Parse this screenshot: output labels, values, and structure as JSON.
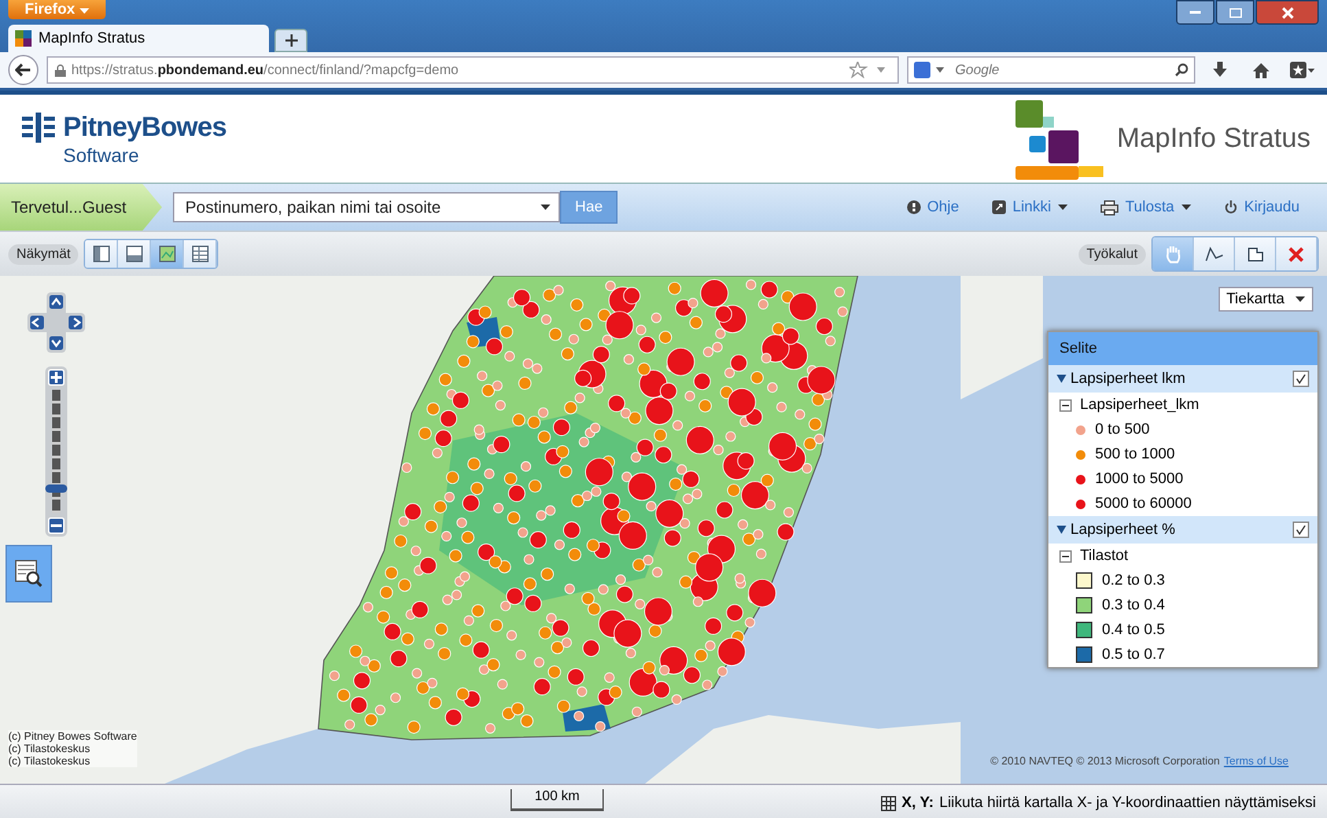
{
  "browser": {
    "app_button": "Firefox",
    "tab_title": "MapInfo Stratus",
    "url": "https://stratus.**pbondemand.eu**/connect/finland/?mapcfg=demo",
    "search_placeholder": "Google"
  },
  "header": {
    "company": "PitneyBowes",
    "company_sub": "Software",
    "product": "MapInfo Stratus"
  },
  "toolbar": {
    "welcome": "Tervetul...Guest",
    "search_placeholder": "Postinumero, paikan nimi tai osoite",
    "search_button": "Hae",
    "links": [
      {
        "label": "Ohje",
        "kind": "help",
        "dropdown": false
      },
      {
        "label": "Linkki",
        "kind": "share",
        "dropdown": true
      },
      {
        "label": "Tulosta",
        "kind": "print",
        "dropdown": true
      },
      {
        "label": "Kirjaudu",
        "kind": "power",
        "dropdown": false
      }
    ]
  },
  "views": {
    "label": "Näkymät",
    "buttons": [
      {
        "kind": "left-panel",
        "selected": false
      },
      {
        "kind": "bottom-panel",
        "selected": false
      },
      {
        "kind": "map",
        "selected": true
      },
      {
        "kind": "table",
        "selected": false
      }
    ]
  },
  "tools": {
    "label": "Työkalut",
    "buttons": [
      {
        "kind": "pan",
        "selected": true
      },
      {
        "kind": "measure",
        "selected": false
      },
      {
        "kind": "area",
        "selected": false
      },
      {
        "kind": "clear",
        "selected": false
      }
    ]
  },
  "map": {
    "basemap": "Tiekartta",
    "zoom_slider": {
      "level": 0.2
    },
    "attribution": [
      "(c) Pitney Bowes Software",
      "(c) Tilastokeskus",
      "(c) Tilastokeskus"
    ],
    "copyright": "© 2010 NAVTEQ © 2013 Microsoft Corporation",
    "terms": "Terms of Use",
    "scale": "100 km"
  },
  "legend": {
    "title": "Selite",
    "layers": [
      {
        "name": "Lapsiperheet lkm",
        "checked": true,
        "expanded": true,
        "group": "Lapsiperheet_lkm",
        "items": [
          {
            "kind": "dot",
            "label": "0 to 500",
            "color": "#f2a38c"
          },
          {
            "kind": "dot",
            "label": "500 to 1000",
            "color": "#f28c0a"
          },
          {
            "kind": "dot",
            "label": "1000 to 5000",
            "color": "#e8131a"
          },
          {
            "kind": "dot",
            "label": "5000 to 60000",
            "color": "#e8131a"
          }
        ]
      },
      {
        "name": "Lapsiperheet %",
        "checked": true,
        "expanded": true,
        "group": "Tilastot",
        "items": [
          {
            "kind": "swatch",
            "label": "0.2 to 0.3",
            "color": "#fdf8cc"
          },
          {
            "kind": "swatch",
            "label": "0.3 to 0.4",
            "color": "#8fd47a"
          },
          {
            "kind": "swatch",
            "label": "0.4 to 0.5",
            "color": "#3fb77c"
          },
          {
            "kind": "swatch",
            "label": "0.5 to 0.7",
            "color": "#1c6aa8"
          }
        ]
      }
    ]
  },
  "status_bar": {
    "coords_label": "X, Y:",
    "coords_hint": "Liikuta hiirtä kartalla X- ja Y-koordinaattien näyttämiseksi"
  }
}
